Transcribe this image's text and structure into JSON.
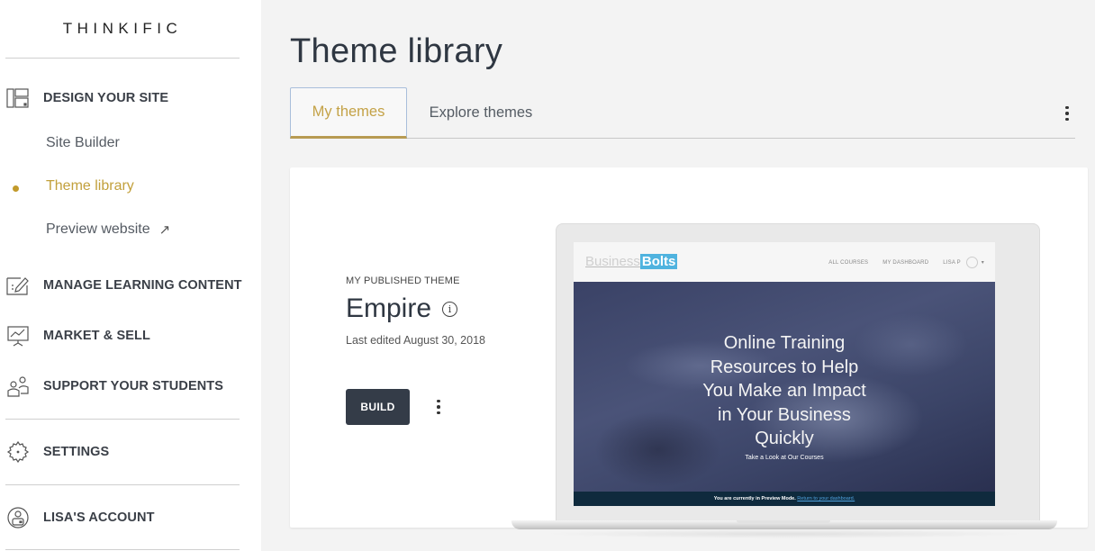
{
  "sidebar": {
    "logo": "THINKIFIC",
    "sections": [
      {
        "label": "DESIGN YOUR SITE",
        "icon": "layout-icon"
      },
      {
        "label": "MANAGE LEARNING CONTENT",
        "icon": "edit-content-icon"
      },
      {
        "label": "MARKET & SELL",
        "icon": "presentation-chart-icon"
      },
      {
        "label": "SUPPORT YOUR STUDENTS",
        "icon": "users-icon"
      },
      {
        "label": "SETTINGS",
        "icon": "gear-icon"
      },
      {
        "label": "LISA'S ACCOUNT",
        "icon": "account-icon"
      }
    ],
    "sub_items": [
      {
        "label": "Site Builder",
        "active": false
      },
      {
        "label": "Theme library",
        "active": true
      },
      {
        "label": "Preview website",
        "active": false,
        "external": true
      }
    ],
    "external_glyph": "↗"
  },
  "main": {
    "title": "Theme library",
    "tabs": [
      {
        "label": "My themes",
        "active": true
      },
      {
        "label": "Explore themes",
        "active": false
      }
    ],
    "card": {
      "kicker": "MY PUBLISHED THEME",
      "theme_name": "Empire",
      "info_glyph": "i",
      "last_edited": "Last edited August 30, 2018",
      "build_label": "BUILD"
    },
    "preview": {
      "logo_part1": "Business",
      "logo_part2": "Bolts",
      "nav": [
        "ALL COURSES",
        "MY DASHBOARD",
        "LISA P"
      ],
      "nav_caret": "▾",
      "hero_title_lines": [
        "Online Training",
        "Resources to Help",
        "You Make an Impact",
        "in Your Business",
        "Quickly"
      ],
      "hero_sub": "Take a Look at Our Courses",
      "preview_notice": "You are currently in Preview Mode.",
      "preview_link": "Return to your dashboard."
    }
  },
  "colors": {
    "accent_gold": "#c2a03c",
    "button_dark": "#343c48",
    "content_bg": "#f3f3f3",
    "preview_brand_blue": "#4fb3df"
  }
}
